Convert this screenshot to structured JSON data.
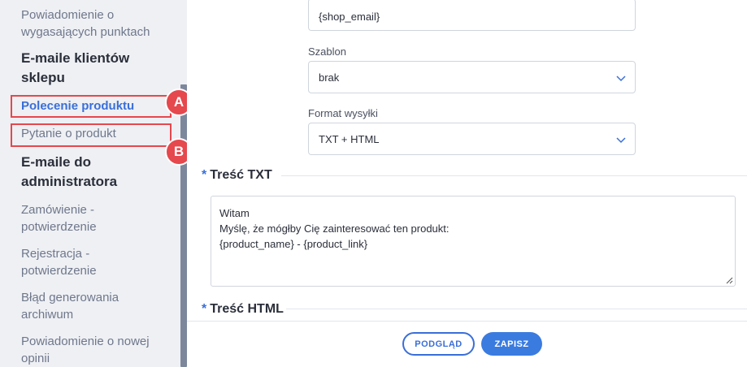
{
  "sidebar": {
    "items": [
      {
        "line1": "Powiadomienie o",
        "line2": "wygasających punktach"
      },
      {
        "heading1": "E-maile klientów",
        "heading2": "sklepu"
      },
      {
        "label": "Polecenie produktu"
      },
      {
        "label": "Pytanie o produkt"
      },
      {
        "heading1": "E-maile do",
        "heading2": "administratora"
      },
      {
        "line1": "Zamówienie -",
        "line2": "potwierdzenie"
      },
      {
        "line1": "Rejestracja -",
        "line2": "potwierdzenie"
      },
      {
        "line1": "Błąd generowania",
        "line2": "archiwum"
      },
      {
        "line1": "Powiadomienie o nowej",
        "line2": "opinii"
      }
    ],
    "markers": [
      "A",
      "B"
    ]
  },
  "form": {
    "email_value": "{shop_email}",
    "template_label": "Szablon",
    "template_value": "brak",
    "format_label": "Format wysyłki",
    "format_value": "TXT + HTML",
    "txt_section": "Treść TXT",
    "html_section": "Treść HTML",
    "required_mark": "*",
    "txt_content": [
      "Witam",
      "Myślę, że mógłby Cię zainteresować ten produkt:",
      "{product_name} - {product_link}"
    ]
  },
  "footer": {
    "preview_label": "PODGLĄD",
    "save_label": "ZAPISZ"
  },
  "colors": {
    "accent": "#3a6fd8",
    "highlight": "#e5484d"
  }
}
